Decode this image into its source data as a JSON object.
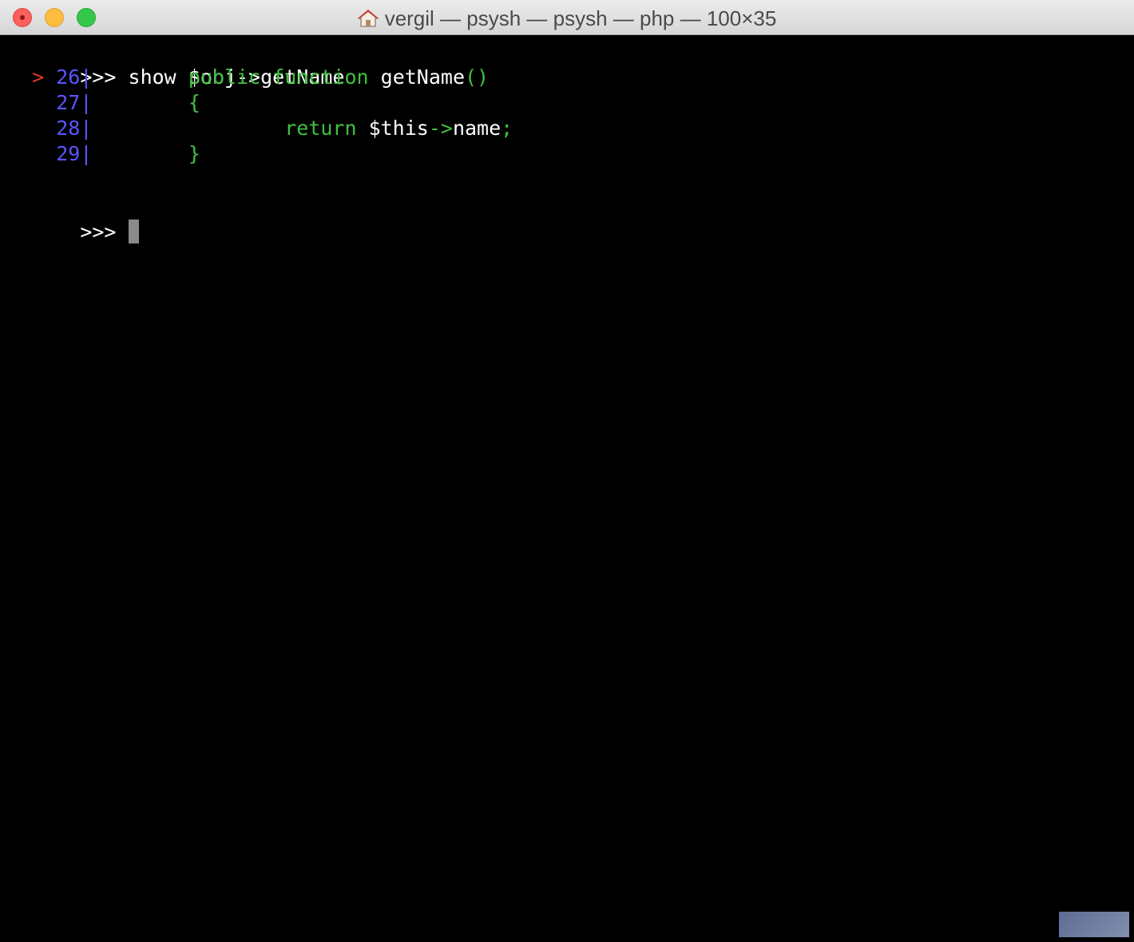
{
  "window": {
    "title": "vergil — psysh — psysh — php — 100×35"
  },
  "terminal": {
    "command_prompt": ">>>",
    "command": "show $obj->getName",
    "source_lines": [
      {
        "marker": ">",
        "lineno": "26",
        "sep": "|",
        "indent": "        ",
        "parts": [
          {
            "text": "public function ",
            "color": "#3fc13f"
          },
          {
            "text": "getName",
            "color": "#ffffff"
          },
          {
            "text": "()",
            "color": "#3fc13f"
          }
        ]
      },
      {
        "marker": " ",
        "lineno": "27",
        "sep": "|",
        "indent": "        ",
        "parts": [
          {
            "text": "{",
            "color": "#3fc13f"
          }
        ]
      },
      {
        "marker": " ",
        "lineno": "28",
        "sep": "|",
        "indent": "                ",
        "parts": [
          {
            "text": "return ",
            "color": "#3fc13f"
          },
          {
            "text": "$this",
            "color": "#ffffff"
          },
          {
            "text": "->",
            "color": "#3fc13f"
          },
          {
            "text": "name",
            "color": "#ffffff"
          },
          {
            "text": ";",
            "color": "#3fc13f"
          }
        ]
      },
      {
        "marker": " ",
        "lineno": "29",
        "sep": "|",
        "indent": "        ",
        "parts": [
          {
            "text": "}",
            "color": "#3fc13f"
          }
        ]
      }
    ],
    "input_prompt": ">>>"
  },
  "colors": {
    "background": "#000000",
    "keyword": "#3fc13f",
    "line_number": "#5b54ff",
    "current_line_marker": "#e03a2c",
    "cursor": "#8a8a8a"
  },
  "icons": {
    "title_icon": "home-icon"
  }
}
